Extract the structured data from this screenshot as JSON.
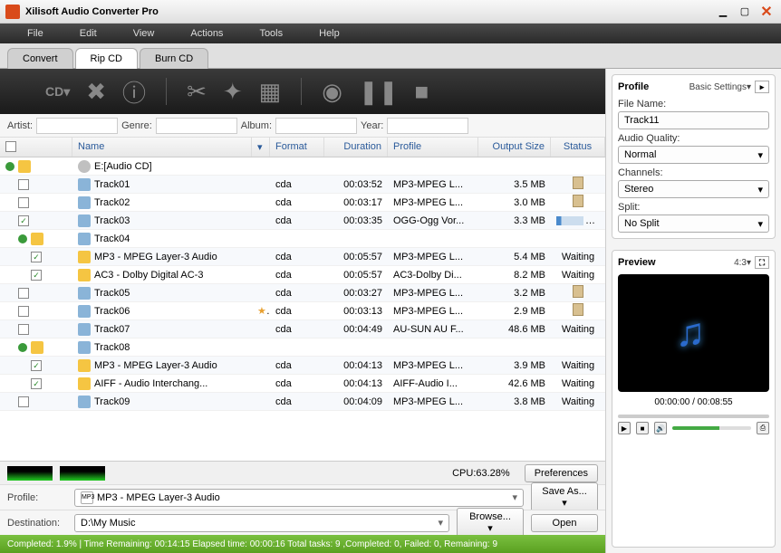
{
  "app_title": "Xilisoft Audio Converter Pro",
  "menu": [
    "File",
    "Edit",
    "View",
    "Actions",
    "Tools",
    "Help"
  ],
  "tabs": [
    "Convert",
    "Rip CD",
    "Burn CD"
  ],
  "active_tab": 1,
  "filters": {
    "artist_label": "Artist:",
    "genre_label": "Genre:",
    "album_label": "Album:",
    "year_label": "Year:"
  },
  "columns": {
    "name": "Name",
    "format": "Format",
    "duration": "Duration",
    "profile": "Profile",
    "output_size": "Output Size",
    "status": "Status"
  },
  "rows": [
    {
      "type": "root",
      "indent": 0,
      "collapse": true,
      "checked": false,
      "icon": "disc",
      "name": "E:[Audio CD]"
    },
    {
      "type": "track",
      "indent": 1,
      "checked": false,
      "icon": "aud",
      "name": "Track01",
      "fmt": "cda",
      "dur": "00:03:52",
      "prof": "MP3-MPEG L...",
      "size": "3.5 MB",
      "stat": "clip"
    },
    {
      "type": "track",
      "indent": 1,
      "checked": false,
      "icon": "aud",
      "name": "Track02",
      "fmt": "cda",
      "dur": "00:03:17",
      "prof": "MP3-MPEG L...",
      "size": "3.0 MB",
      "stat": "clip"
    },
    {
      "type": "track",
      "indent": 1,
      "checked": true,
      "icon": "aud",
      "name": "Track03",
      "fmt": "cda",
      "dur": "00:03:35",
      "prof": "OGG-Ogg Vor...",
      "size": "3.3 MB",
      "stat": "prog",
      "pct": "18.7%"
    },
    {
      "type": "folder",
      "indent": 1,
      "collapse": true,
      "checked": false,
      "icon": "aud",
      "name": "Track04"
    },
    {
      "type": "track",
      "indent": 2,
      "checked": true,
      "icon": "fold",
      "name": "MP3 - MPEG Layer-3 Audio",
      "fmt": "cda",
      "dur": "00:05:57",
      "prof": "MP3-MPEG L...",
      "size": "5.4 MB",
      "stat": "Waiting"
    },
    {
      "type": "track",
      "indent": 2,
      "checked": true,
      "icon": "fold",
      "name": "AC3 - Dolby Digital AC-3",
      "fmt": "cda",
      "dur": "00:05:57",
      "prof": "AC3-Dolby Di...",
      "size": "8.2 MB",
      "stat": "Waiting"
    },
    {
      "type": "track",
      "indent": 1,
      "checked": false,
      "icon": "aud",
      "name": "Track05",
      "fmt": "cda",
      "dur": "00:03:27",
      "prof": "MP3-MPEG L...",
      "size": "3.2 MB",
      "stat": "clip"
    },
    {
      "type": "track",
      "indent": 1,
      "checked": false,
      "icon": "aud",
      "name": "Track06",
      "star": true,
      "fmt": "cda",
      "dur": "00:03:13",
      "prof": "MP3-MPEG L...",
      "size": "2.9 MB",
      "stat": "clip"
    },
    {
      "type": "track",
      "indent": 1,
      "checked": false,
      "icon": "aud",
      "name": "Track07",
      "fmt": "cda",
      "dur": "00:04:49",
      "prof": "AU-SUN AU F...",
      "size": "48.6 MB",
      "stat": "Waiting"
    },
    {
      "type": "folder",
      "indent": 1,
      "collapse": true,
      "checked": false,
      "icon": "aud",
      "name": "Track08"
    },
    {
      "type": "track",
      "indent": 2,
      "checked": true,
      "icon": "fold",
      "name": "MP3 - MPEG Layer-3 Audio",
      "fmt": "cda",
      "dur": "00:04:13",
      "prof": "MP3-MPEG L...",
      "size": "3.9 MB",
      "stat": "Waiting"
    },
    {
      "type": "track",
      "indent": 2,
      "checked": true,
      "icon": "fold",
      "name": "AIFF - Audio Interchang...",
      "fmt": "cda",
      "dur": "00:04:13",
      "prof": "AIFF-Audio I...",
      "size": "42.6 MB",
      "stat": "Waiting"
    },
    {
      "type": "track",
      "indent": 1,
      "checked": false,
      "icon": "aud",
      "name": "Track09",
      "fmt": "cda",
      "dur": "00:04:09",
      "prof": "MP3-MPEG L...",
      "size": "3.8 MB",
      "stat": "Waiting"
    }
  ],
  "cpu_label": "CPU:63.28%",
  "preferences_btn": "Preferences",
  "profile_label": "Profile:",
  "profile_value": "MP3 - MPEG Layer-3 Audio",
  "saveas_btn": "Save As...",
  "dest_label": "Destination:",
  "dest_value": "D:\\My Music",
  "browse_btn": "Browse...",
  "open_btn": "Open",
  "status_text": "Completed: 1.9% | Time Remaining: 00:14:15 Elapsed time: 00:00:16 Total tasks: 9 ,Completed: 0, Failed: 0, Remaining: 9",
  "side": {
    "profile_hdr": "Profile",
    "basic_settings": "Basic Settings▾",
    "filename_label": "File Name:",
    "filename_value": "Track11",
    "quality_label": "Audio Quality:",
    "quality_value": "Normal",
    "channels_label": "Channels:",
    "channels_value": "Stereo",
    "split_label": "Split:",
    "split_value": "No Split",
    "preview_hdr": "Preview",
    "aspect": "4:3▾",
    "time": "00:00:00 / 00:08:55"
  }
}
